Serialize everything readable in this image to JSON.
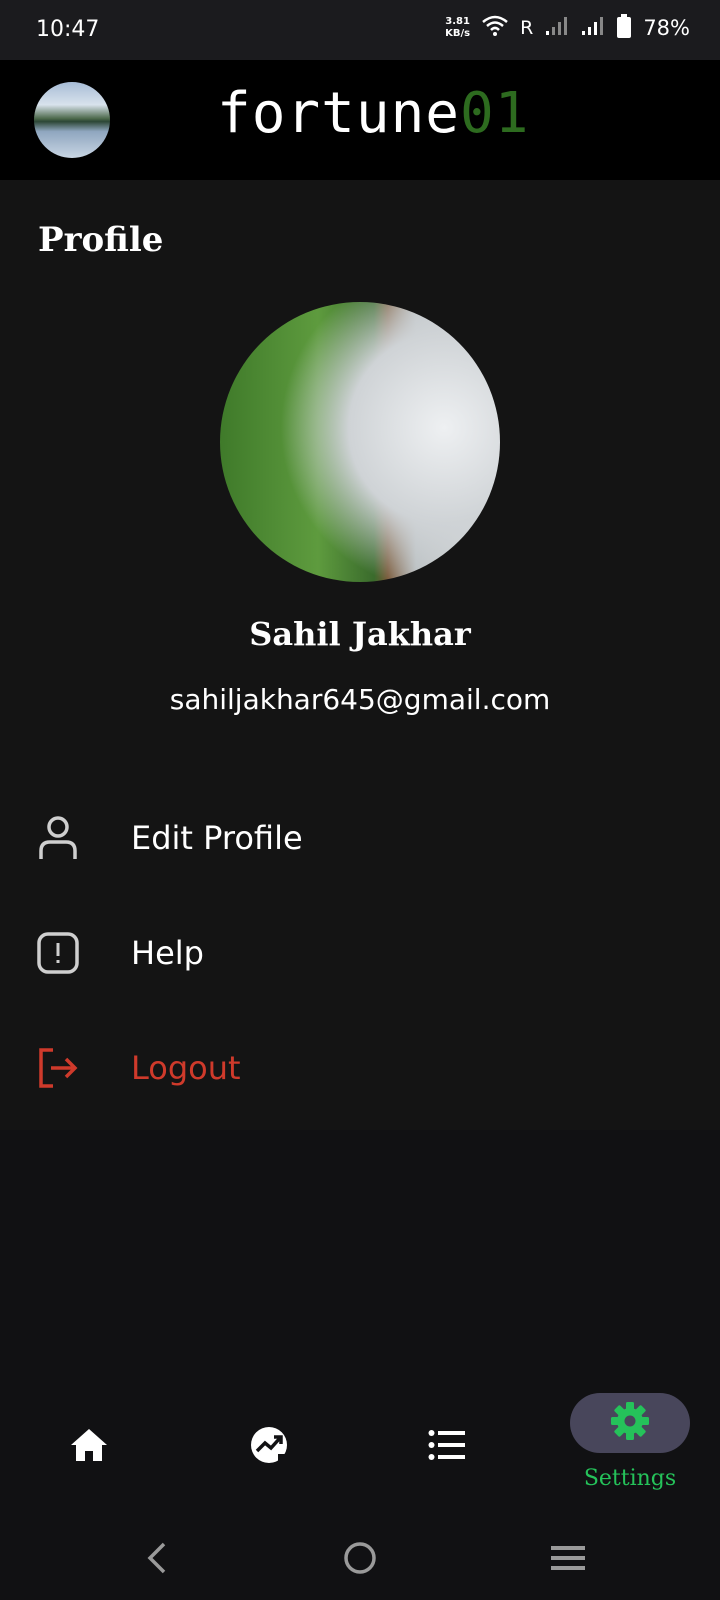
{
  "status_bar": {
    "time": "10:47",
    "net_speed_value": "3.81",
    "net_speed_unit": "KB/s",
    "roaming": "R",
    "battery": "78%"
  },
  "app_bar": {
    "brand_part1": "fortune",
    "brand_part2": "01"
  },
  "profile": {
    "title": "Profile",
    "name": "Sahil Jakhar",
    "email": "sahiljakhar645@gmail.com"
  },
  "menu": {
    "edit_profile": "Edit Profile",
    "help": "Help",
    "logout": "Logout"
  },
  "bottom_nav": {
    "settings_label": "Settings"
  },
  "colors": {
    "accent_green": "#25c25a",
    "logout_red": "#cf3a2b",
    "brand_green": "#2d6b1f"
  },
  "icons": {
    "home": "home-icon",
    "markets": "trending-icon",
    "list": "list-icon",
    "settings": "gear-icon"
  }
}
